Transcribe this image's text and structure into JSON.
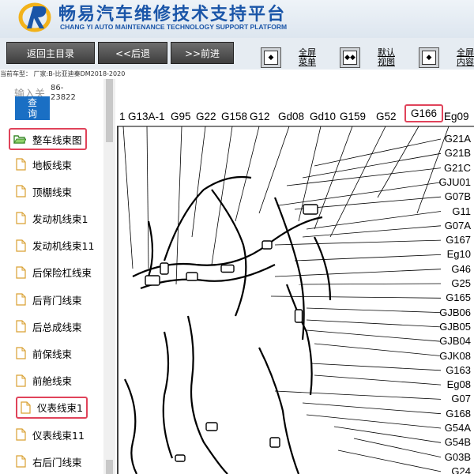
{
  "header": {
    "title_cn": "畅易汽车维修技术支持平台",
    "title_en": "CHANG YI AUTO MAINTENANCE TECHNOLOGY SUPPORT PLATFORM",
    "brand_color": "#1a55a8"
  },
  "toolbar": {
    "back_home": "返回主目录",
    "back": "<<后退",
    "forward": ">>前进",
    "fullscreen_menu": [
      "全屏",
      "菜单"
    ],
    "default_view": [
      "默认",
      "视图"
    ],
    "fullscreen_content": [
      "全屏",
      "内容"
    ]
  },
  "model_line": "当前车型： 厂家:B-比亚迪秦DM2018-2020",
  "sidebar": {
    "search_label": "输入关",
    "search_value": "86-23822",
    "query_button": [
      "查",
      "询"
    ],
    "root_folder": "整车线束图",
    "items": [
      "地板线束",
      "顶棚线束",
      "发动机线束1",
      "发动机线束11",
      "后保险杠线束",
      "后背门线束",
      "后总成线束",
      "前保线束",
      "前舱线束",
      "仪表线束1",
      "仪表线束11",
      "右后门线束"
    ],
    "highlight_color": "#e0435a"
  },
  "diagram": {
    "top_labels": [
      "1",
      "G13A-1",
      "G95",
      "G22",
      "G158",
      "G12",
      "Gd08",
      "Gd10",
      "G159",
      "G52",
      "G166",
      "Eg09"
    ],
    "right_labels": [
      "G21A",
      "G21B",
      "G21C",
      "GJU01",
      "G07B",
      "G11",
      "G07A",
      "G167",
      "Eg10",
      "G46",
      "G25",
      "G165",
      "GJB06",
      "GJB05",
      "GJB04",
      "GJK08",
      "G163",
      "Eg08",
      "G07",
      "G168",
      "G54A",
      "G54B",
      "G03B",
      "G24"
    ]
  }
}
